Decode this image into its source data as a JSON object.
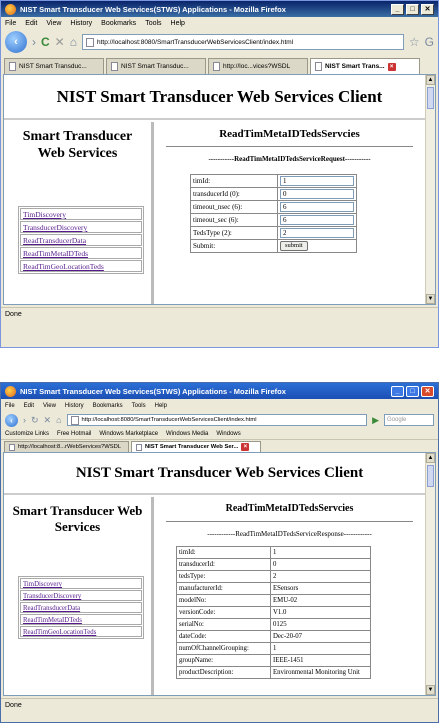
{
  "shot1": {
    "window_title": "NIST Smart Transducer Web Services(STWS) Applications - Mozilla Firefox",
    "menu": [
      "File",
      "Edit",
      "View",
      "History",
      "Bookmarks",
      "Tools",
      "Help"
    ],
    "url": "http://localhost:8080/SmartTransducerWebServicesClient/index.html",
    "tabs": [
      "NIST Smart Transduc...",
      "NIST Smart Transduc...",
      "http://loc...vices?WSDL",
      "NIST Smart Trans..."
    ],
    "page": {
      "header": "NIST Smart Transducer Web Services Client",
      "left_title": "Smart Transducer Web Services",
      "links": [
        "TimDiscovery",
        "TransducerDiscovery",
        "ReadTransducerData",
        "ReadTimMetaIDTeds",
        "ReadTimGeoLocationTeds"
      ],
      "service_title": "ReadTimMetaIDTedsServcies",
      "request_title": "-----------ReadTimMetaIDTedsServiceRequest-----------",
      "form": [
        {
          "label": "timId:",
          "value": "1"
        },
        {
          "label": "transducerId (0):",
          "value": "0"
        },
        {
          "label": "timeout_nsec (6):",
          "value": "6"
        },
        {
          "label": "timeout_sec (6):",
          "value": "6"
        },
        {
          "label": "TedsType (2):",
          "value": "2"
        }
      ],
      "submit_label": "Submit:",
      "submit_button": "submit"
    },
    "status": "Done"
  },
  "shot2": {
    "window_title": "NIST Smart Transducer Web Services(STWS) Applications - Mozilla Firefox",
    "menu": [
      "File",
      "Edit",
      "View",
      "History",
      "Bookmarks",
      "Tools",
      "Help"
    ],
    "url": "http://localhost:8080/SmartTransducerWebServicesClient/index.html",
    "search_placeholder": "Google",
    "bookmarks": [
      "Customize Links",
      "Free Hotmail",
      "Windows Marketplace",
      "Windows Media",
      "Windows"
    ],
    "tabs": [
      "http://localhost:8...rWebServices?WSDL",
      "NIST Smart Transducer Web Ser..."
    ],
    "page": {
      "header": "NIST Smart Transducer Web Services Client",
      "left_title": "Smart Transducer Web Services",
      "links": [
        "TimDiscovery",
        "TransducerDiscovery",
        "ReadTransducerData",
        "ReadTimMetaIDTeds",
        "ReadTimGeoLocationTeds"
      ],
      "service_title": "ReadTimMetaIDTedsServcies",
      "response_title": "------------ReadTimMetaIDTedsServiceResponse------------",
      "rows": [
        {
          "label": "timId:",
          "value": "1"
        },
        {
          "label": "transducerId:",
          "value": "0"
        },
        {
          "label": "tedsType:",
          "value": "2"
        },
        {
          "label": "manufacturerId:",
          "value": "ESensors"
        },
        {
          "label": "modelNo:",
          "value": "EMU-02"
        },
        {
          "label": "versionCode:",
          "value": "V1.0"
        },
        {
          "label": "serialNo:",
          "value": "0125"
        },
        {
          "label": "dateCode:",
          "value": "Dec-20-07"
        },
        {
          "label": "numOfChannelGrouping:",
          "value": "1"
        },
        {
          "label": "groupName:",
          "value": "IEEE-1451"
        },
        {
          "label": "productDescription:",
          "value": "Environmental Monitoring Unit"
        }
      ]
    },
    "status": "Done"
  }
}
